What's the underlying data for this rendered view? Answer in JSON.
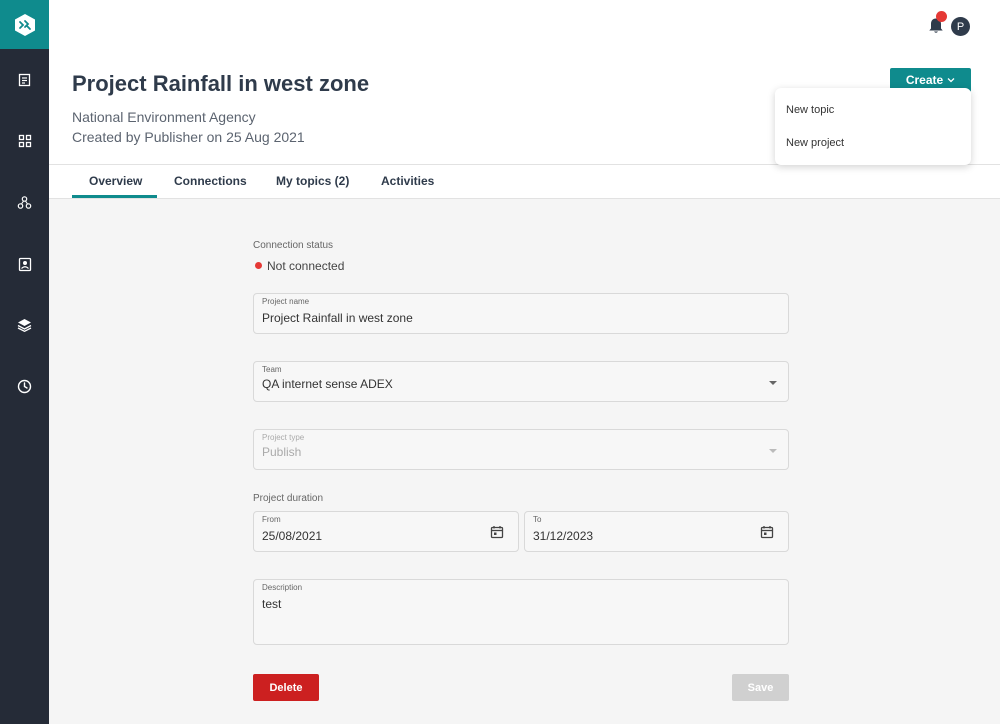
{
  "sidebar": {
    "items": [
      {
        "icon": "document-list-icon"
      },
      {
        "icon": "grid-icon"
      },
      {
        "icon": "network-icon"
      },
      {
        "icon": "contact-book-icon"
      },
      {
        "icon": "layers-icon"
      },
      {
        "icon": "clock-icon"
      }
    ]
  },
  "header": {
    "title": "Project Rainfall in west zone",
    "agency": "National Environment Agency",
    "created": "Created by Publisher on 25 Aug 2021",
    "avatar_initial": "P"
  },
  "create_menu": {
    "button_label": "Create",
    "items": [
      "New topic",
      "New project"
    ]
  },
  "tabs": [
    {
      "label": "Overview",
      "active": true
    },
    {
      "label": "Connections",
      "active": false
    },
    {
      "label": "My topics (2)",
      "active": false
    },
    {
      "label": "Activities",
      "active": false
    }
  ],
  "form": {
    "connection_status_label": "Connection status",
    "connection_status_value": "Not connected",
    "project_name_label": "Project name",
    "project_name_value": "Project Rainfall in west zone",
    "team_label": "Team",
    "team_value": "QA internet sense ADEX",
    "project_type_label": "Project type",
    "project_type_value": "Publish",
    "duration_label": "Project duration",
    "from_label": "From",
    "from_value": "25/08/2021",
    "to_label": "To",
    "to_value": "31/12/2023",
    "description_label": "Description",
    "description_value": "test",
    "delete_label": "Delete",
    "save_label": "Save"
  },
  "colors": {
    "accent": "#0f8b8d",
    "sidebar": "#252b37",
    "danger": "#cc2020",
    "status_red": "#e53935"
  }
}
